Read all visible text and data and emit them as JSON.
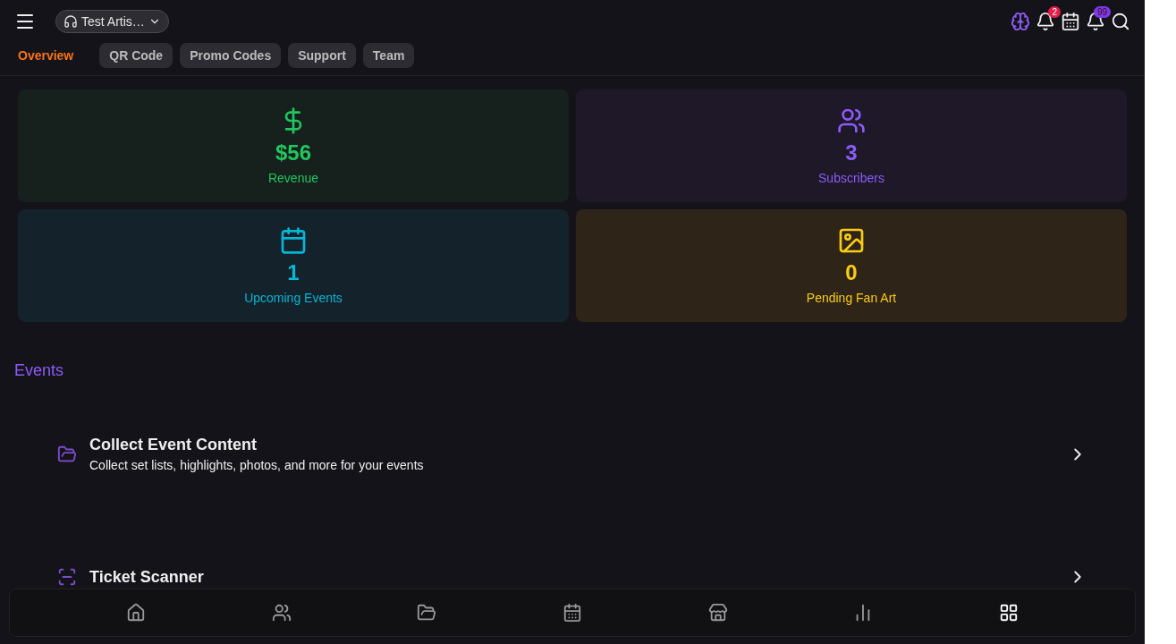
{
  "header": {
    "artist": "Test Artis…",
    "notifications_badge": "2",
    "alerts_badge": "99"
  },
  "tabs": [
    {
      "label": "Overview",
      "selected": true
    },
    {
      "label": "QR Code",
      "selected": false
    },
    {
      "label": "Promo Codes",
      "selected": false
    },
    {
      "label": "Support",
      "selected": false
    },
    {
      "label": "Team",
      "selected": false
    }
  ],
  "stats": [
    {
      "kind": "revenue",
      "value": "$56",
      "label": "Revenue",
      "color": "#22c55e"
    },
    {
      "kind": "subscribers",
      "value": "3",
      "label": "Subscribers",
      "color": "#8b5cf6"
    },
    {
      "kind": "events",
      "value": "1",
      "label": "Upcoming Events",
      "color": "#06b6d4"
    },
    {
      "kind": "fanart",
      "value": "0",
      "label": "Pending Fan Art",
      "color": "#facc15"
    }
  ],
  "section_title": "Events",
  "actions": [
    {
      "kind": "folder",
      "title": "Collect Event Content",
      "description": "Collect set lists, highlights, photos, and more for your events"
    },
    {
      "kind": "scanner",
      "title": "Ticket Scanner"
    }
  ],
  "bottom_nav": [
    {
      "kind": "home",
      "selected": false
    },
    {
      "kind": "people",
      "selected": false
    },
    {
      "kind": "folder",
      "selected": false
    },
    {
      "kind": "calendar",
      "selected": false
    },
    {
      "kind": "store",
      "selected": false
    },
    {
      "kind": "chart",
      "selected": false
    },
    {
      "kind": "grid",
      "selected": true
    }
  ]
}
